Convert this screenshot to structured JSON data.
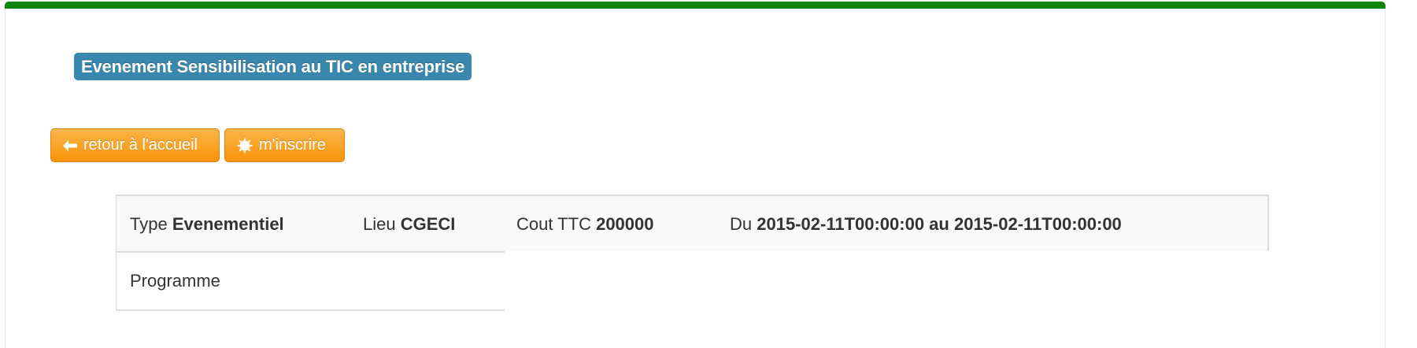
{
  "event": {
    "title": "Evenement Sensibilisation au TIC en entreprise"
  },
  "actions": {
    "back_label": "retour à l'accueil",
    "back_icon": "arrow-left-icon",
    "register_label": "m'inscrire",
    "register_icon": "sun-burst-icon"
  },
  "details": {
    "type_label": "Type",
    "type_value": "Evenementiel",
    "lieu_label": "Lieu",
    "lieu_value": "CGECI",
    "cout_label": "Cout TTC",
    "cout_value": "200000",
    "du_label": "Du",
    "du_value": "2015-02-11T00:00:00 au 2015-02-11T00:00:00",
    "programme_label": "Programme"
  },
  "colors": {
    "top_bar": "#108510",
    "title_badge": "#3a87ad",
    "button": "#f89406"
  }
}
